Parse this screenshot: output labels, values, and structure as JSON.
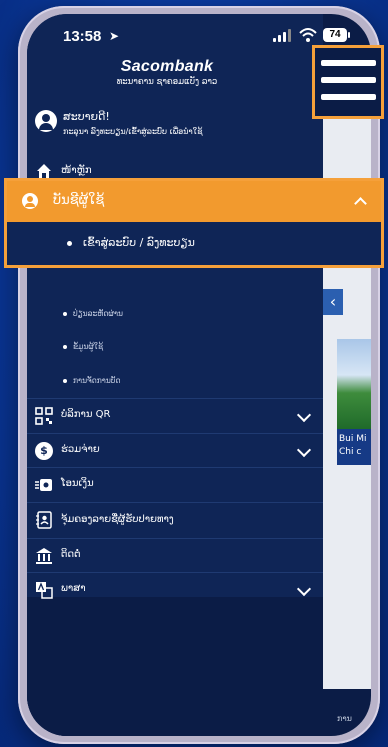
{
  "status_bar": {
    "time": "13:58",
    "battery": "74"
  },
  "brand": {
    "name": "Sacombank",
    "subtitle": "ທະນາຄານ ຊາຄອມແບັງ ລາວ"
  },
  "user": {
    "greeting": "ສະບາຍດີ!",
    "login_prompt": "ກະລຸນາ ລົງທະບຽນ/ເຂົ້າສູ່ລະບົບ ເພື່ອນຳໃຊ້"
  },
  "menu": {
    "home": "ໜ້າຫຼັກ",
    "card_services": {
      "label": "ບັນຊີຜູ້ໃຊ້",
      "selected_sub": "ເຂົ້າສູ່ລະບົບ / ລົງທະບຽນ",
      "subs": [
        "ປ່ຽນລະຫັດຜ່ານ",
        "ຂໍ້ມູນຜູ້ໃຊ້",
        "ການຈັດການບັດ"
      ]
    },
    "qr_payment": "ບໍລິການ QR",
    "loans": "ຮ່ວມຈ່າຍ",
    "transfer": "ໂອນເງິນ",
    "beneficiaries": "ຈຸ້ມຄອງລາຍຊື່ຜູ້ຮັບປາຍທາງ",
    "contact": "ຕິດຕໍ່",
    "language": "ພາສາ"
  },
  "peek": {
    "card_line1": "Bui Mi",
    "card_line2": "Chi c",
    "tab_label": "ການ"
  },
  "colors": {
    "accent": "#f29a2e",
    "menu_bg": "#0f2556",
    "outline": "#f5a03a"
  },
  "icons": [
    "person-icon",
    "home-icon",
    "qr-icon",
    "coin-icon",
    "transfer-icon",
    "contacts-icon",
    "bank-icon",
    "language-icon",
    "hamburger-icon"
  ]
}
